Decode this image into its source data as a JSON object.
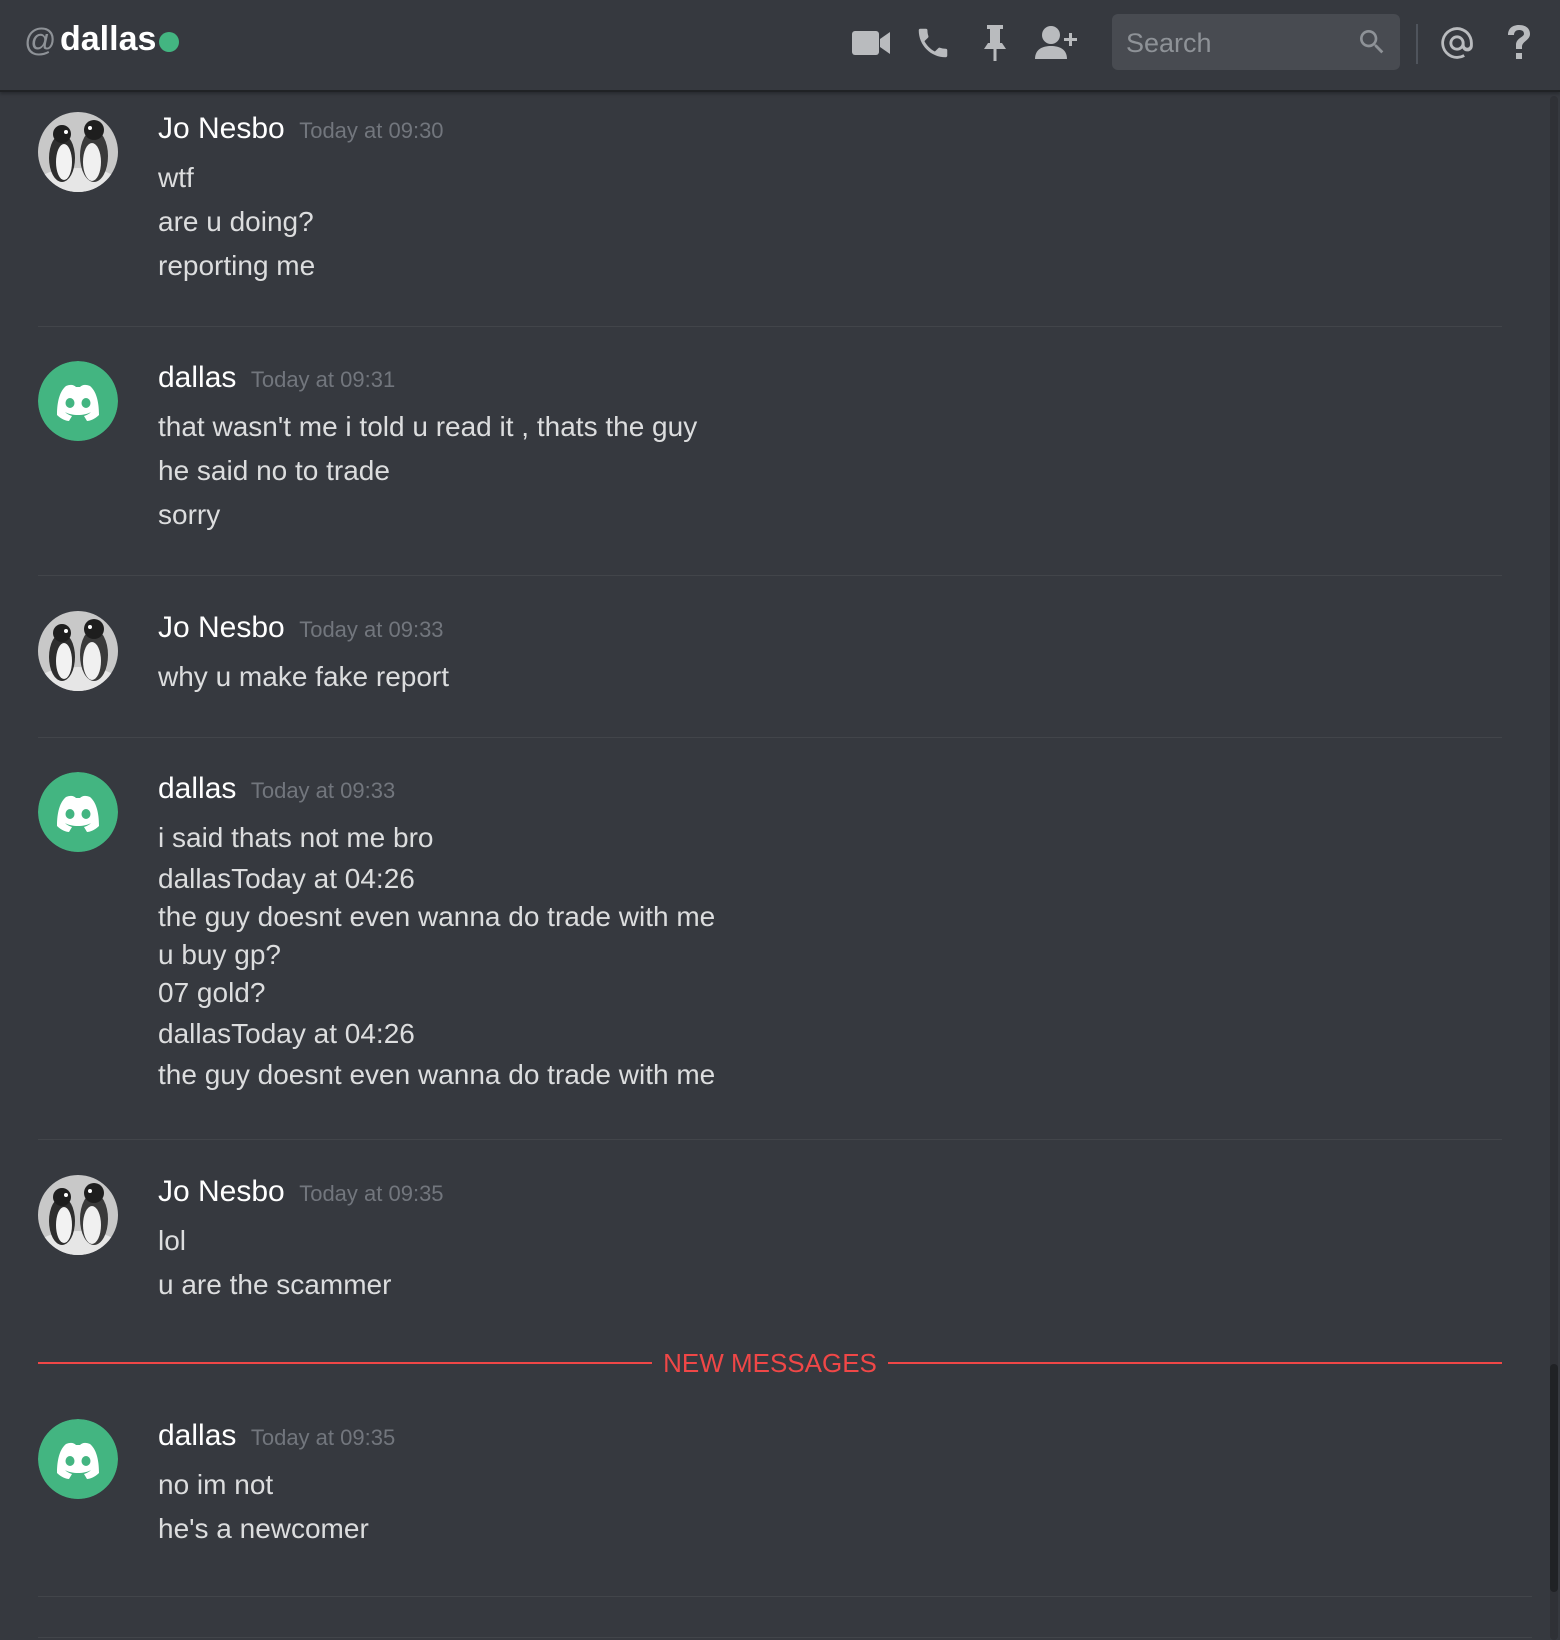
{
  "header": {
    "at_symbol": "@",
    "channel_name": "dallas",
    "status": "online",
    "status_color": "#43b581",
    "icons": [
      "video-icon",
      "phone-icon",
      "pin-icon",
      "add-friend-icon",
      "mention-icon",
      "help-icon"
    ],
    "search_placeholder": "Search"
  },
  "divider": {
    "label": "NEW MESSAGES",
    "color": "#f04747"
  },
  "avatars": {
    "jo": "penguin-photo-avatar",
    "dallas": "discord-logo-avatar",
    "dallas_color": "#43b581"
  },
  "messages": [
    {
      "author": "Jo Nesbo",
      "timestamp": "Today at 09:30",
      "lines": [
        "wtf",
        "are u doing?",
        "reporting me"
      ]
    },
    {
      "author": "dallas",
      "timestamp": "Today at 09:31",
      "lines": [
        "that wasn't me i told u read it , thats the guy",
        "he said no to trade",
        "sorry"
      ]
    },
    {
      "author": "Jo Nesbo",
      "timestamp": "Today at 09:33",
      "lines": [
        "why u make fake report"
      ]
    },
    {
      "author": "dallas",
      "timestamp": "Today at 09:33",
      "lines": [
        "i said thats not me bro",
        "dallasToday at 04:26",
        "the guy doesnt even wanna do trade with me",
        "u buy gp?",
        "07 gold?",
        "dallasToday at 04:26",
        "the guy doesnt even wanna do trade with me"
      ]
    },
    {
      "author": "Jo Nesbo",
      "timestamp": "Today at 09:35",
      "lines": [
        "lol",
        "u are the scammer"
      ]
    },
    {
      "author": "dallas",
      "timestamp": "Today at 09:35",
      "lines": [
        "no im not",
        "he's a newcomer"
      ]
    }
  ]
}
